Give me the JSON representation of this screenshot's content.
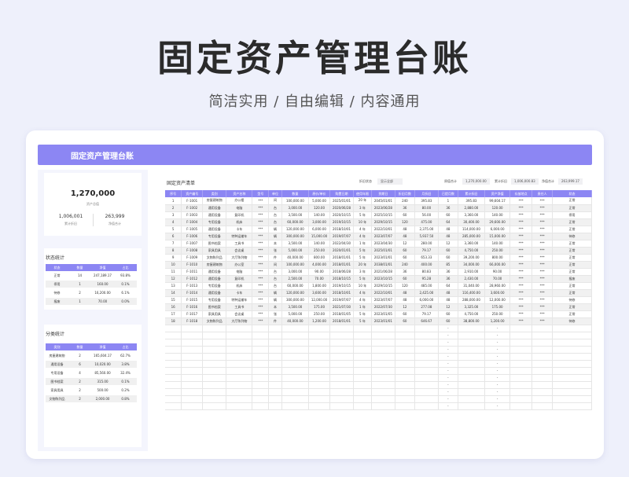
{
  "hero": {
    "title": "固定资产管理台账",
    "subtitle": "简洁实用 / 自由编辑 / 内容通用"
  },
  "banner": {
    "title": "固定资产管理台账"
  },
  "summary": {
    "total": "1,270,000",
    "total_label": "资产总值",
    "depreciation": "1,006,001",
    "depreciation_label": "累计折旧",
    "net": "263,999",
    "net_label": "净值合计"
  },
  "status_stats": {
    "title": "状态统计",
    "headers": [
      "状态",
      "数量",
      "净值",
      "占比"
    ],
    "rows": [
      [
        "正常",
        "14",
        "247,189.17",
        "93.8%"
      ],
      [
        "停用",
        "1",
        "160.00",
        "0.1%"
      ],
      [
        "待修",
        "2",
        "16,200.00",
        "6.1%"
      ],
      [
        "报废",
        "1",
        "70.00",
        "0.0%"
      ]
    ]
  },
  "category_stats": {
    "title": "分类统计",
    "headers": [
      "类别",
      "数量",
      "净值",
      "占比"
    ],
    "rows": [
      [
        "房屋建筑物",
        "2",
        "165,604.17",
        "62.7%"
      ],
      [
        "通用设备",
        "6",
        "10,020.00",
        "3.8%"
      ],
      [
        "专用设备",
        "4",
        "85,560.00",
        "32.4%"
      ],
      [
        "图书档案",
        "2",
        "315.00",
        "0.1%"
      ],
      [
        "家具用具",
        "2",
        "500.00",
        "0.2%"
      ],
      [
        "文物陈列品",
        "2",
        "2,000.00",
        "0.8%"
      ]
    ]
  },
  "list": {
    "title": "固定资产清单",
    "filter_label": "折旧状态",
    "filter_value": "显示全部",
    "total_label": "原值合计",
    "total_value": "1,270,000.00",
    "dep_label": "累计折旧",
    "dep_value": "1,006,000.83",
    "net_label": "净值合计",
    "net_value": "263,999.17",
    "headers": [
      "序号",
      "资产编号",
      "类别",
      "资产名称",
      "型号",
      "单位",
      "数量",
      "原价/单价",
      "购置日期",
      "使用年限",
      "到期日",
      "折旧月数",
      "月折旧",
      "已提月数",
      "累计折旧",
      "资产净值",
      "存放地点",
      "责任人",
      "状态"
    ],
    "rows": [
      [
        "1",
        "F-1001",
        "房屋建筑物",
        "办公楼",
        "***",
        "间",
        "100,000.00",
        "5,000.00",
        "2025/01/01",
        "20 年",
        "2045/01/01",
        "240",
        "395.83",
        "1",
        "395.83",
        "99,604.17",
        "***",
        "***",
        "正常"
      ],
      [
        "2",
        "F-1002",
        "通用设备",
        "电脑",
        "***",
        "台",
        "3,000.00",
        "120.00",
        "2020/06/28",
        "3 年",
        "2023/06/28",
        "36",
        "80.00",
        "36",
        "2,880.00",
        "120.00",
        "***",
        "***",
        "正常"
      ],
      [
        "3",
        "F-1003",
        "通用设备",
        "复印机",
        "***",
        "台",
        "3,500.00",
        "140.00",
        "2020/10/15",
        "5 年",
        "2025/10/15",
        "60",
        "56.00",
        "60",
        "3,360.00",
        "140.00",
        "***",
        "***",
        "停用"
      ],
      [
        "4",
        "F-1004",
        "专用设备",
        "机床",
        "***",
        "台",
        "60,000.00",
        "3,000.00",
        "2019/10/15",
        "10 年",
        "2029/10/15",
        "120",
        "475.00",
        "64",
        "30,400.00",
        "29,600.00",
        "***",
        "***",
        "正常"
      ],
      [
        "5",
        "F-1005",
        "通用设备",
        "卡车",
        "***",
        "辆",
        "120,000.00",
        "6,000.00",
        "2018/10/01",
        "4 年",
        "2022/10/01",
        "48",
        "2,375.00",
        "48",
        "114,000.00",
        "6,000.00",
        "***",
        "***",
        "正常"
      ],
      [
        "6",
        "F-1006",
        "专用设备",
        "特种运输车",
        "***",
        "辆",
        "300,000.00",
        "15,000.00",
        "2019/07/07",
        "4 年",
        "2023/07/07",
        "48",
        "5,937.50",
        "48",
        "285,000.00",
        "15,000.00",
        "***",
        "***",
        "待修"
      ],
      [
        "7",
        "F-1007",
        "图书档案",
        "工具书",
        "***",
        "本",
        "3,500.00",
        "140.00",
        "2022/04/30",
        "1 年",
        "2023/04/30",
        "12",
        "280.00",
        "12",
        "3,360.00",
        "140.00",
        "***",
        "***",
        "正常"
      ],
      [
        "8",
        "F-1008",
        "家具用具",
        "会议桌",
        "***",
        "张",
        "5,000.00",
        "250.00",
        "2020/01/01",
        "5 年",
        "2025/01/01",
        "60",
        "79.17",
        "60",
        "4,750.00",
        "250.00",
        "***",
        "***",
        "正常"
      ],
      [
        "9",
        "F-1009",
        "文物陈列品",
        "大厅陈列物",
        "***",
        "件",
        "40,000.00",
        "800.00",
        "2018/01/01",
        "5 年",
        "2023/01/01",
        "60",
        "653.33",
        "60",
        "39,200.00",
        "800.00",
        "***",
        "***",
        "正常"
      ],
      [
        "10",
        "F-1010",
        "房屋建筑物",
        "办公室",
        "***",
        "间",
        "100,000.00",
        "4,000.00",
        "2018/01/01",
        "20 年",
        "2038/01/01",
        "240",
        "400.00",
        "85",
        "34,000.00",
        "66,000.00",
        "***",
        "***",
        "正常"
      ],
      [
        "11",
        "F-1011",
        "通用设备",
        "电脑",
        "***",
        "台",
        "3,000.00",
        "90.00",
        "2018/06/28",
        "3 年",
        "2021/06/28",
        "36",
        "80.83",
        "36",
        "2,910.00",
        "90.00",
        "***",
        "***",
        "正常"
      ],
      [
        "12",
        "F-1012",
        "通用设备",
        "复印机",
        "***",
        "台",
        "2,500.00",
        "70.00",
        "2018/10/15",
        "5 年",
        "2023/10/15",
        "60",
        "95.28",
        "36",
        "2,430.00",
        "70.00",
        "***",
        "***",
        "报废"
      ],
      [
        "13",
        "F-1013",
        "专用设备",
        "机床",
        "***",
        "台",
        "60,000.00",
        "1,800.00",
        "2019/10/15",
        "10 年",
        "2029/10/15",
        "120",
        "485.00",
        "64",
        "31,040.00",
        "28,960.00",
        "***",
        "***",
        "正常"
      ],
      [
        "14",
        "F-1014",
        "通用设备",
        "卡车",
        "***",
        "辆",
        "120,000.00",
        "3,600.00",
        "2018/10/01",
        "4 年",
        "2022/10/01",
        "48",
        "2,425.00",
        "48",
        "116,400.00",
        "3,600.00",
        "***",
        "***",
        "正常"
      ],
      [
        "15",
        "F-1015",
        "专用设备",
        "特种运输车",
        "***",
        "辆",
        "300,000.00",
        "12,000.00",
        "2019/07/07",
        "4 年",
        "2023/07/07",
        "48",
        "6,000.00",
        "48",
        "288,000.00",
        "12,000.00",
        "***",
        "***",
        "待修"
      ],
      [
        "16",
        "F-1016",
        "图书档案",
        "工具书",
        "***",
        "本",
        "3,500.00",
        "175.00",
        "2021/07/30",
        "1 年",
        "2022/07/30",
        "12",
        "277.08",
        "12",
        "3,325.00",
        "175.00",
        "***",
        "***",
        "正常"
      ],
      [
        "17",
        "F-1017",
        "家具用具",
        "会议桌",
        "***",
        "张",
        "5,000.00",
        "250.00",
        "2018/01/05",
        "5 年",
        "2023/01/05",
        "60",
        "79.17",
        "60",
        "4,750.00",
        "250.00",
        "***",
        "***",
        "正常"
      ],
      [
        "18",
        "F-1018",
        "文物陈列品",
        "大厅陈列物",
        "***",
        "件",
        "40,000.00",
        "1,200.00",
        "2018/01/01",
        "5 年",
        "2023/01/01",
        "60",
        "646.67",
        "60",
        "38,800.00",
        "1,200.00",
        "***",
        "***",
        "待修"
      ]
    ],
    "empty_rows": 12,
    "empty_marker": "-"
  }
}
